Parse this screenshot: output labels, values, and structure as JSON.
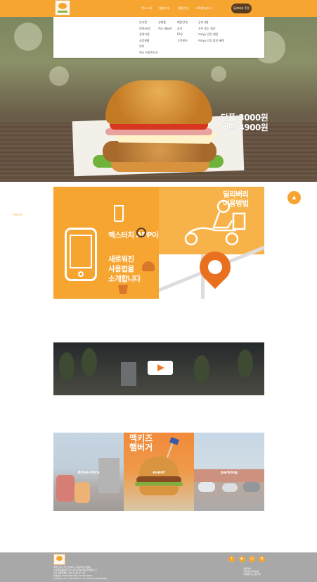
{
  "header": {
    "nav": [
      "맥스소개",
      "제품소개",
      "매장안내",
      "고객센터/소식"
    ],
    "order_button": "딜리버리 주문"
  },
  "dropdown": {
    "columns": [
      [
        "인사말",
        "연혁/비전",
        "경영이념",
        "사업현황",
        "위치",
        "맥스 프랜차이즈"
      ],
      [
        "신제품",
        "맥스 메뉴판"
      ],
      [
        "매장안내",
        "공지",
        "FAQ",
        "고객센터"
      ],
      [
        "공지사항",
        "자주 묻는 질문",
        "mayy 인증 매장",
        "mayy 인증 할인 혜택"
      ]
    ]
  },
  "hero": {
    "price_single": "단품:3000원",
    "price_set": "세트:4900원"
  },
  "side_label": "맥스터치",
  "top_button": "▲",
  "banners": {
    "app": {
      "title": "맥스터치 APP이용방법",
      "line1": "새로워진",
      "line2": "사용법을",
      "line3": "소개합니다"
    },
    "delivery": {
      "title_line1": "딜리버리",
      "title_line2": "이용방법"
    }
  },
  "features": {
    "drive": "drive-thru",
    "event": "event",
    "parking": "parking",
    "event_headline_1": "맥키즈",
    "event_headline_2": "햄버거"
  },
  "footer": {
    "info": [
      "㈜맥스터치 맥스트레이드 대표자명 홍길동",
      "사업자등록번호 123-45-67890 통신판매업신고",
      "주소 서울특별시 강남구 맥스로 123",
      "대표번호 1588-0000 팩스 02-000-0000",
      "COPYRIGHT ⓒ MAXTOUCH. ALL RIGHTS RESERVED."
    ],
    "links": [
      "이용약관",
      "개인정보처리방침",
      "이메일무단수집거부"
    ]
  },
  "colors": {
    "brand_orange": "#f6a531",
    "brown": "#5a3b1e",
    "footer_gray": "#a8a8a8"
  },
  "icons": {
    "social": [
      "facebook-icon",
      "youtube-icon",
      "instagram-icon",
      "blog-icon"
    ]
  }
}
